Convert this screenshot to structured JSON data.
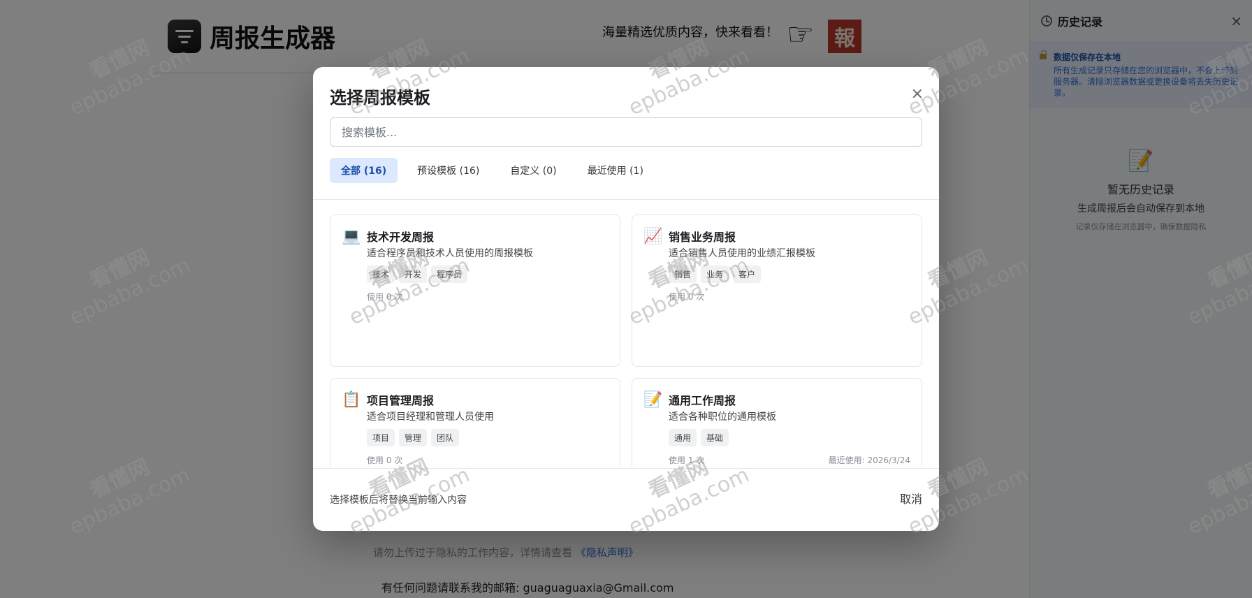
{
  "app": {
    "title": "周报生成器",
    "promo_text": "海量精选优质内容，快来看看！",
    "badge_char": "報"
  },
  "page_footer": {
    "privacy_text": "请勿上传过于隐私的工作内容，详情请查看",
    "privacy_link": "《隐私声明》",
    "contact": "有任何问题请联系我的邮箱: guaguaguaxia@Gmail.com"
  },
  "sidebar": {
    "title": "历史记录",
    "close_glyph": "×",
    "notice_title": "数据仅保存在本地",
    "notice_text": "所有生成记录只存储在您的浏览器中，不会上传到服务器。清除浏览器数据或更换设备将丢失历史记录。",
    "empty_icon": "📝",
    "empty_title": "暂无历史记录",
    "empty_sub": "生成周报后会自动保存到本地",
    "empty_hint": "记录仅存储在浏览器中，确保数据隐私"
  },
  "modal": {
    "title": "选择周报模板",
    "close_glyph": "×",
    "search_placeholder": "搜索模板...",
    "tabs": [
      {
        "label": "全部 (16)"
      },
      {
        "label": "预设模板 (16)"
      },
      {
        "label": "自定义 (0)"
      },
      {
        "label": "最近使用 (1)"
      }
    ],
    "cards": [
      {
        "icon": "💻",
        "title": "技术开发周报",
        "desc": "适合程序员和技术人员使用的周报模板",
        "tags": [
          "技术",
          "开发",
          "程序员"
        ],
        "usage": "使用 0 次",
        "recent": ""
      },
      {
        "icon": "📈",
        "title": "销售业务周报",
        "desc": "适合销售人员使用的业绩汇报模板",
        "tags": [
          "销售",
          "业务",
          "客户"
        ],
        "usage": "使用 0 次",
        "recent": ""
      },
      {
        "icon": "📋",
        "title": "项目管理周报",
        "desc": "适合项目经理和管理人员使用",
        "tags": [
          "项目",
          "管理",
          "团队"
        ],
        "usage": "使用 0 次",
        "recent": ""
      },
      {
        "icon": "📝",
        "title": "通用工作周报",
        "desc": "适合各种职位的通用模板",
        "tags": [
          "通用",
          "基础"
        ],
        "usage": "使用 1 次",
        "recent": "最近使用: 2026/3/24"
      }
    ],
    "footer_note": "选择模板后将替换当前输入内容",
    "cancel_label": "取消"
  },
  "watermark": {
    "cn": "看懂网",
    "en": "epbaba.com"
  }
}
